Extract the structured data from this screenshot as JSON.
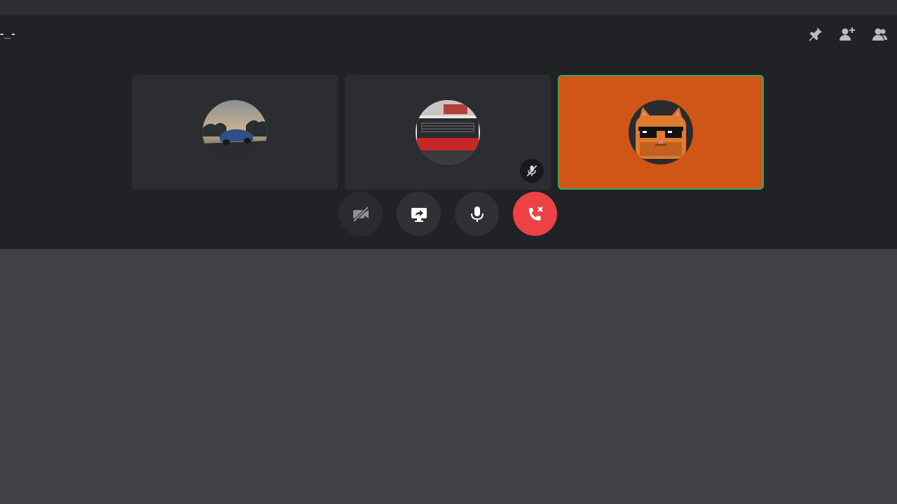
{
  "window": {
    "channel_name": "-_-"
  },
  "header": {
    "icons": [
      "pin-icon",
      "add-friend-icon",
      "members-icon"
    ]
  },
  "participants": [
    {
      "avatar": "car-photo-avatar",
      "muted": false,
      "speaking": false
    },
    {
      "avatar": "red-car-photo-avatar",
      "muted": true,
      "speaking": false
    },
    {
      "avatar": "pixel-cat-sunglasses-avatar",
      "muted": false,
      "speaking": true,
      "tile_color": "#cf5616"
    }
  ],
  "controls": {
    "items": [
      "camera-off-icon",
      "screen-share-icon",
      "microphone-icon",
      "disconnect-icon"
    ]
  },
  "colors": {
    "speaking_border": "#3ba55c",
    "disconnect": "#ed4245",
    "call_background": "#202225",
    "chat_background": "#3f4146"
  }
}
